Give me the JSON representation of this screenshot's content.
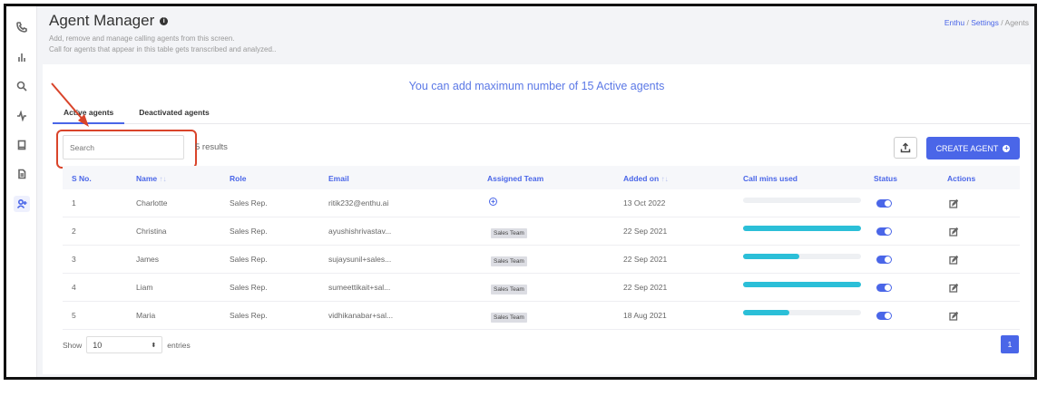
{
  "header": {
    "title": "Agent Manager",
    "subtitle_1": "Add, remove and manage calling agents from this screen.",
    "subtitle_2": "Call for agents that appear in this table gets transcribed and analyzed.."
  },
  "breadcrumb": {
    "item1": "Enthu",
    "sep1": " / ",
    "item2": "Settings",
    "sep2": " / ",
    "item3": "Agents"
  },
  "notice": "You can add maximum number of 15 Active agents",
  "tabs": {
    "active": "Active agents",
    "deactivated": "Deactivated agents"
  },
  "search": {
    "placeholder": "Search"
  },
  "results_text": "5 results",
  "create_button": "CREATE AGENT",
  "columns": {
    "sno": "S No.",
    "name": "Name",
    "role": "Role",
    "email": "Email",
    "team": "Assigned Team",
    "added": "Added on",
    "callmins": "Call mins used",
    "status": "Status",
    "actions": "Actions"
  },
  "rows": [
    {
      "sno": "1",
      "name": "Charlotte",
      "role": "Sales Rep.",
      "email": "ritik232@enthu.ai",
      "team": "",
      "added": "13 Oct 2022",
      "callmins_fraction": 0.0,
      "status_on": true
    },
    {
      "sno": "2",
      "name": "Christina",
      "role": "Sales Rep.",
      "email": "ayushishrivastav...",
      "team": "Sales Team",
      "added": "22 Sep 2021",
      "callmins_fraction": 1.0,
      "status_on": true
    },
    {
      "sno": "3",
      "name": "James",
      "role": "Sales Rep.",
      "email": "sujaysunil+sales...",
      "team": "Sales Team",
      "added": "22 Sep 2021",
      "callmins_fraction": 0.48,
      "status_on": true
    },
    {
      "sno": "4",
      "name": "Liam",
      "role": "Sales Rep.",
      "email": "sumeettikait+sal...",
      "team": "Sales Team",
      "added": "22 Sep 2021",
      "callmins_fraction": 1.0,
      "status_on": true
    },
    {
      "sno": "5",
      "name": "Maria",
      "role": "Sales Rep.",
      "email": "vidhikanabar+sal...",
      "team": "Sales Team",
      "added": "18 Aug 2021",
      "callmins_fraction": 0.39,
      "status_on": true
    }
  ],
  "pagination": {
    "show_label": "Show",
    "entries_value": "10",
    "entries_label": "entries",
    "current_page": "1"
  },
  "colors": {
    "accent": "#4a66e8",
    "progress": "#2bbfd8",
    "annotation": "#d9442a"
  },
  "icons": [
    "phone-icon",
    "bar-chart-icon",
    "search-icon",
    "activity-icon",
    "book-icon",
    "document-icon",
    "add-user-icon",
    "info-icon",
    "upload-icon",
    "edit-icon",
    "plus-circle-icon"
  ]
}
